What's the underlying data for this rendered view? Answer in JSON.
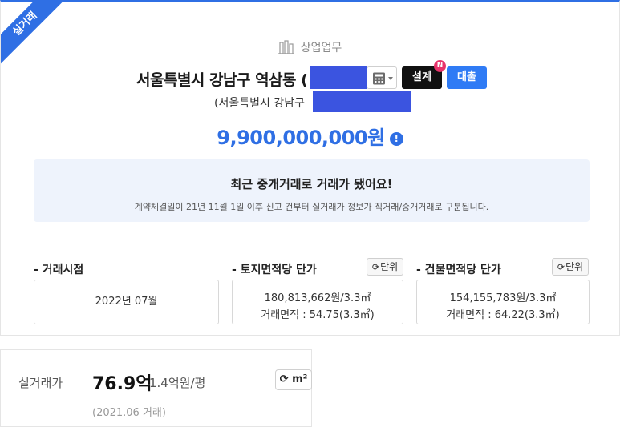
{
  "ribbon": "실거래",
  "category": "상업업무",
  "address": "서울특별시 강남구 역삼동 (",
  "sub_address": "(서울특별시 강남구",
  "buttons": {
    "design": "설계",
    "design_badge": "N",
    "loan": "대출"
  },
  "price": "9,900,000,000원",
  "notice": {
    "title": "최근 중개거래로 거래가 됐어요!",
    "desc": "계약체결일이 21년 11월 1일 이후 신고 건부터 실거래가 정보가 직거래/중개거래로 구분됩니다."
  },
  "columns": {
    "time_label": "- 거래시점",
    "time_value": "2022년 07월",
    "land_label": "- 토지면적당 단가",
    "land_price": "180,813,662원/3.3㎡",
    "land_area": "거래면적 : 54.75(3.3㎡)",
    "building_label": "- 건물면적당 단가",
    "building_price": "154,155,783원/3.3㎡",
    "building_area": "거래면적 : 64.22(3.3㎡)",
    "unit_button": "단위"
  },
  "bottom": {
    "label": "실거래가",
    "price": "76.9억",
    "per_unit": "1.4억원/평",
    "toggle": "m²",
    "date": "(2021.06 거래)"
  },
  "colors": {
    "accent": "#2f6fe4",
    "redaction": "#3b54e0",
    "notice_bg": "#eef3fc"
  }
}
